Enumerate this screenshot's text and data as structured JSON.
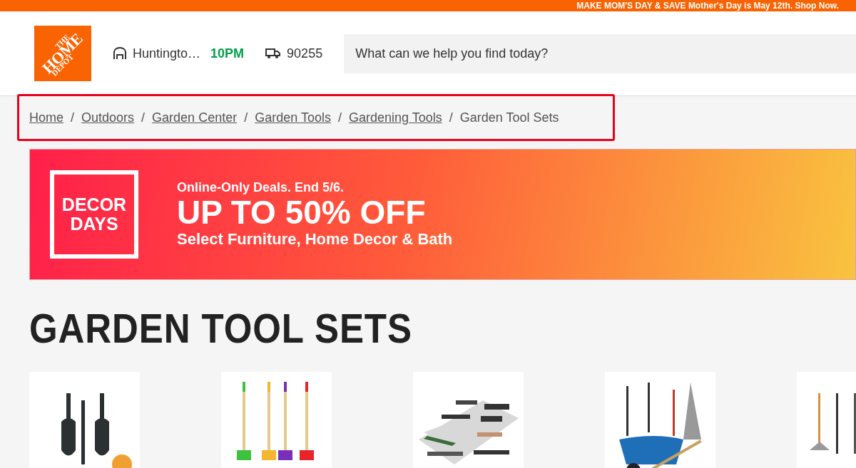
{
  "promo_bar": {
    "text": "MAKE MOM'S DAY & SAVE Mother's Day is May 12th. Shop Now."
  },
  "header": {
    "logo": {
      "lines": [
        "THE",
        "HOME",
        "DEPOT"
      ]
    },
    "store": "Huntingto…",
    "store_hours": "10PM",
    "zip": "90255",
    "search": {
      "placeholder": "What can we help you find today?"
    }
  },
  "breadcrumbs": [
    {
      "label": "Home",
      "link": true
    },
    {
      "label": "Outdoors",
      "link": true
    },
    {
      "label": "Garden Center",
      "link": true
    },
    {
      "label": "Garden Tools",
      "link": true
    },
    {
      "label": "Gardening Tools",
      "link": true
    },
    {
      "label": "Garden Tool Sets",
      "link": false
    }
  ],
  "breadcrumb_separator": "/",
  "banner": {
    "badge": [
      "DECOR",
      "DAYS"
    ],
    "kicker": "Online-Only Deals. End 5/6.",
    "headline": "UP TO 50% OFF",
    "subline": "Select Furniture, Home Decor & Bath"
  },
  "page_title": "GARDEN TOOL SETS"
}
